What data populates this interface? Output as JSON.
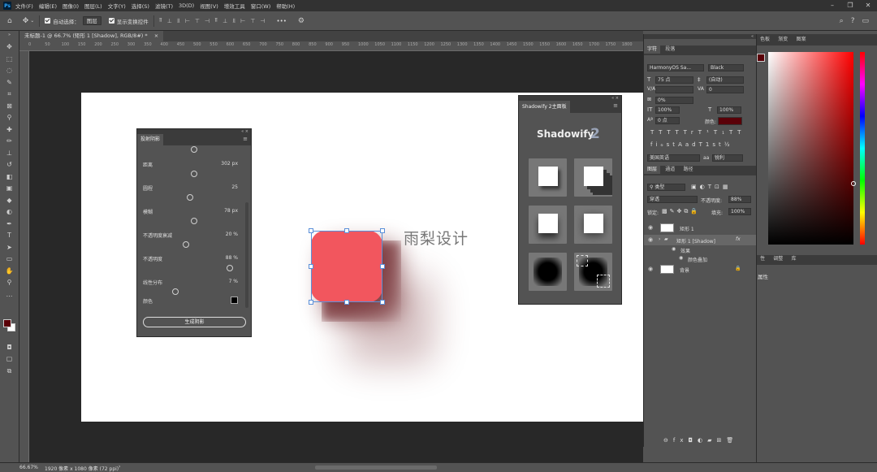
{
  "menubar": {
    "logo": "Ps",
    "items": [
      "文件(F)",
      "编辑(E)",
      "图像(I)",
      "图层(L)",
      "文字(Y)",
      "选择(S)",
      "滤镜(T)",
      "3D(D)",
      "视图(V)",
      "增效工具",
      "窗口(W)",
      "帮助(H)"
    ]
  },
  "window_controls": {
    "minimize": "–",
    "restore": "❐",
    "close": "✕"
  },
  "options_bar": {
    "auto_select_label": "自动选择：",
    "auto_select_value": "图层",
    "transform_controls_label": "显示变换控件",
    "more": "•••"
  },
  "document_tab": {
    "title": "未标题-1 @ 66.7% (矩形 1 [Shadow], RGB/8#) *",
    "close": "×"
  },
  "ruler_ticks": [
    "0",
    "50",
    "100",
    "150",
    "200",
    "250",
    "300",
    "350",
    "400",
    "450",
    "500",
    "550",
    "600",
    "650",
    "700",
    "750",
    "800",
    "850",
    "900",
    "950",
    "1000",
    "1050",
    "1100",
    "1150",
    "1200",
    "1250",
    "1300",
    "1350",
    "1400",
    "1450",
    "1500",
    "1550",
    "1600",
    "1650",
    "1700",
    "1750",
    "1800"
  ],
  "canvas": {
    "text": "雨梨设计",
    "shape_color": "#f2565e",
    "shadow_color": "#5e0d12"
  },
  "shadow_panel": {
    "tab": "投射阴影",
    "params": [
      {
        "label": "距离",
        "value": "302 px",
        "level": 0.3
      },
      {
        "label": "圆程",
        "value": "25",
        "level": 0.25
      },
      {
        "label": "模糊",
        "value": "78 px",
        "level": 0.3
      },
      {
        "label": "不透明度衰减",
        "value": "20 %",
        "level": 0.2
      },
      {
        "label": "不透明度",
        "value": "88 %",
        "level": 0.88
      },
      {
        "label": "线性分布",
        "value": "7 %",
        "level": 0.07
      }
    ],
    "color_label": "颜色",
    "generate_button": "生成阴影"
  },
  "shadowify_panel": {
    "tab": "Shadowify 2主面板",
    "logo": "Shadowify",
    "logo_num": "2"
  },
  "character_panel": {
    "tabs": [
      "字符",
      "段落"
    ],
    "font_family": "HarmonyOS Sa...",
    "font_style": "Black",
    "font_size": "75 点",
    "leading": "(自动)",
    "tracking_label": "V/A",
    "kerning": "0",
    "tracking_percent": "0%",
    "vscale": "100%",
    "hscale": "100%",
    "baseline": "0 点",
    "color_label": "颜色:",
    "text_color": "#5a0008",
    "style_buttons": [
      "T",
      "T",
      "TT",
      "Tr",
      "T¹",
      "T₁",
      "T",
      "T"
    ],
    "ot_buttons": [
      "fi",
      "ℴ",
      "st",
      "A",
      "ad",
      "T",
      "1st",
      "½"
    ],
    "language": "美国英语",
    "aa_icon": "aa",
    "antialias": "锐利"
  },
  "layers_panel": {
    "tabs": [
      "图层",
      "通道",
      "路径"
    ],
    "filter_label": "类型",
    "blend_mode": "穿透",
    "opacity_label": "不透明度:",
    "opacity": "88%",
    "lock_label": "锁定:",
    "fill_label": "填充:",
    "fill": "100%",
    "layers": [
      {
        "name": "矩形 1",
        "kind": "shape"
      },
      {
        "name": "矩形 1 [Shadow]",
        "kind": "group",
        "fx": "fx"
      },
      {
        "name": "效果",
        "kind": "effect"
      },
      {
        "name": "颜色叠加",
        "kind": "effect"
      },
      {
        "name": "背景",
        "kind": "background"
      }
    ]
  },
  "color_panel": {
    "tabs": [
      "色板",
      "渐变",
      "图案"
    ]
  },
  "properties_panel": {
    "tabs": [
      "性",
      "调整",
      "库"
    ],
    "title": "属性"
  },
  "status": {
    "zoom": "66.67%",
    "doc_info": "1920 像素 x 1080 像素 (72 ppi)",
    "arrow": "›"
  }
}
